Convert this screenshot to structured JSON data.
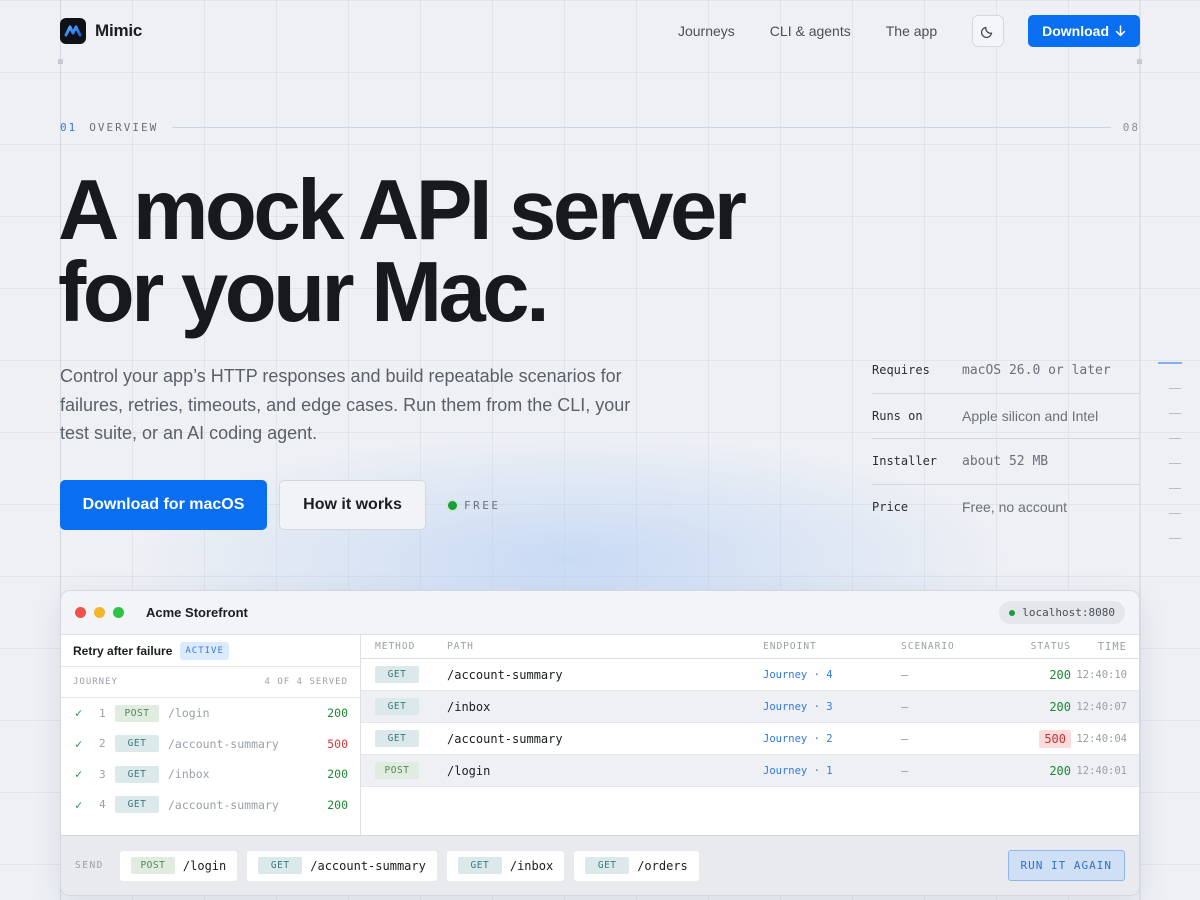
{
  "nav": {
    "brand": "Mimic",
    "links": [
      "Journeys",
      "CLI & agents",
      "The app"
    ],
    "download": "Download"
  },
  "section": {
    "number": "01",
    "label": "OVERVIEW",
    "end": "08"
  },
  "hero": {
    "title_line1": "A mock API server",
    "title_line2": "for your Mac.",
    "subtitle": "Control your app’s HTTP responses and build repeatable scenarios for failures, retries, timeouts, and edge cases. Run them from the CLI, your test suite, or an AI coding agent.",
    "cta_primary": "Download for macOS",
    "cta_secondary": "How it works",
    "badge": "FREE"
  },
  "specs": [
    {
      "key": "Requires",
      "value": "macOS 26.0 or later"
    },
    {
      "key": "Runs on",
      "value": "Apple silicon and Intel"
    },
    {
      "key": "Installer",
      "value": "about 52 MB"
    },
    {
      "key": "Price",
      "value": "Free, no account"
    }
  ],
  "window": {
    "title": "Acme Storefront",
    "host": "localhost:8080",
    "journey": {
      "name": "Retry after failure",
      "badge": "ACTIVE",
      "label": "JOURNEY",
      "served": "4 OF 4 SERVED",
      "steps": [
        {
          "num": "1",
          "method": "POST",
          "path": "/login",
          "status": "200"
        },
        {
          "num": "2",
          "method": "GET",
          "path": "/account-summary",
          "status": "500"
        },
        {
          "num": "3",
          "method": "GET",
          "path": "/inbox",
          "status": "200"
        },
        {
          "num": "4",
          "method": "GET",
          "path": "/account-summary",
          "status": "200"
        }
      ]
    },
    "table": {
      "headers": [
        "METHOD",
        "PATH",
        "ENDPOINT",
        "SCENARIO",
        "STATUS",
        "TIME"
      ],
      "rows": [
        {
          "method": "GET",
          "path": "/account-summary",
          "endpoint": "Journey · 4",
          "scenario": "—",
          "status": "200",
          "time": "12:40:10"
        },
        {
          "method": "GET",
          "path": "/inbox",
          "endpoint": "Journey · 3",
          "scenario": "—",
          "status": "200",
          "time": "12:40:07"
        },
        {
          "method": "GET",
          "path": "/account-summary",
          "endpoint": "Journey · 2",
          "scenario": "—",
          "status": "500",
          "time": "12:40:04"
        },
        {
          "method": "POST",
          "path": "/login",
          "endpoint": "Journey · 1",
          "scenario": "—",
          "status": "200",
          "time": "12:40:01"
        }
      ]
    },
    "send": {
      "label": "SEND",
      "chips": [
        {
          "method": "POST",
          "path": "/login"
        },
        {
          "method": "GET",
          "path": "/account-summary"
        },
        {
          "method": "GET",
          "path": "/inbox"
        },
        {
          "method": "GET",
          "path": "/orders"
        }
      ],
      "run": "RUN IT AGAIN"
    }
  },
  "colors": {
    "accent": "#0a6ef0",
    "success": "#1a8a34",
    "error": "#d03a3a",
    "traffic_red": "#f0524a",
    "traffic_yellow": "#f5b52a",
    "traffic_green": "#2ec443"
  }
}
